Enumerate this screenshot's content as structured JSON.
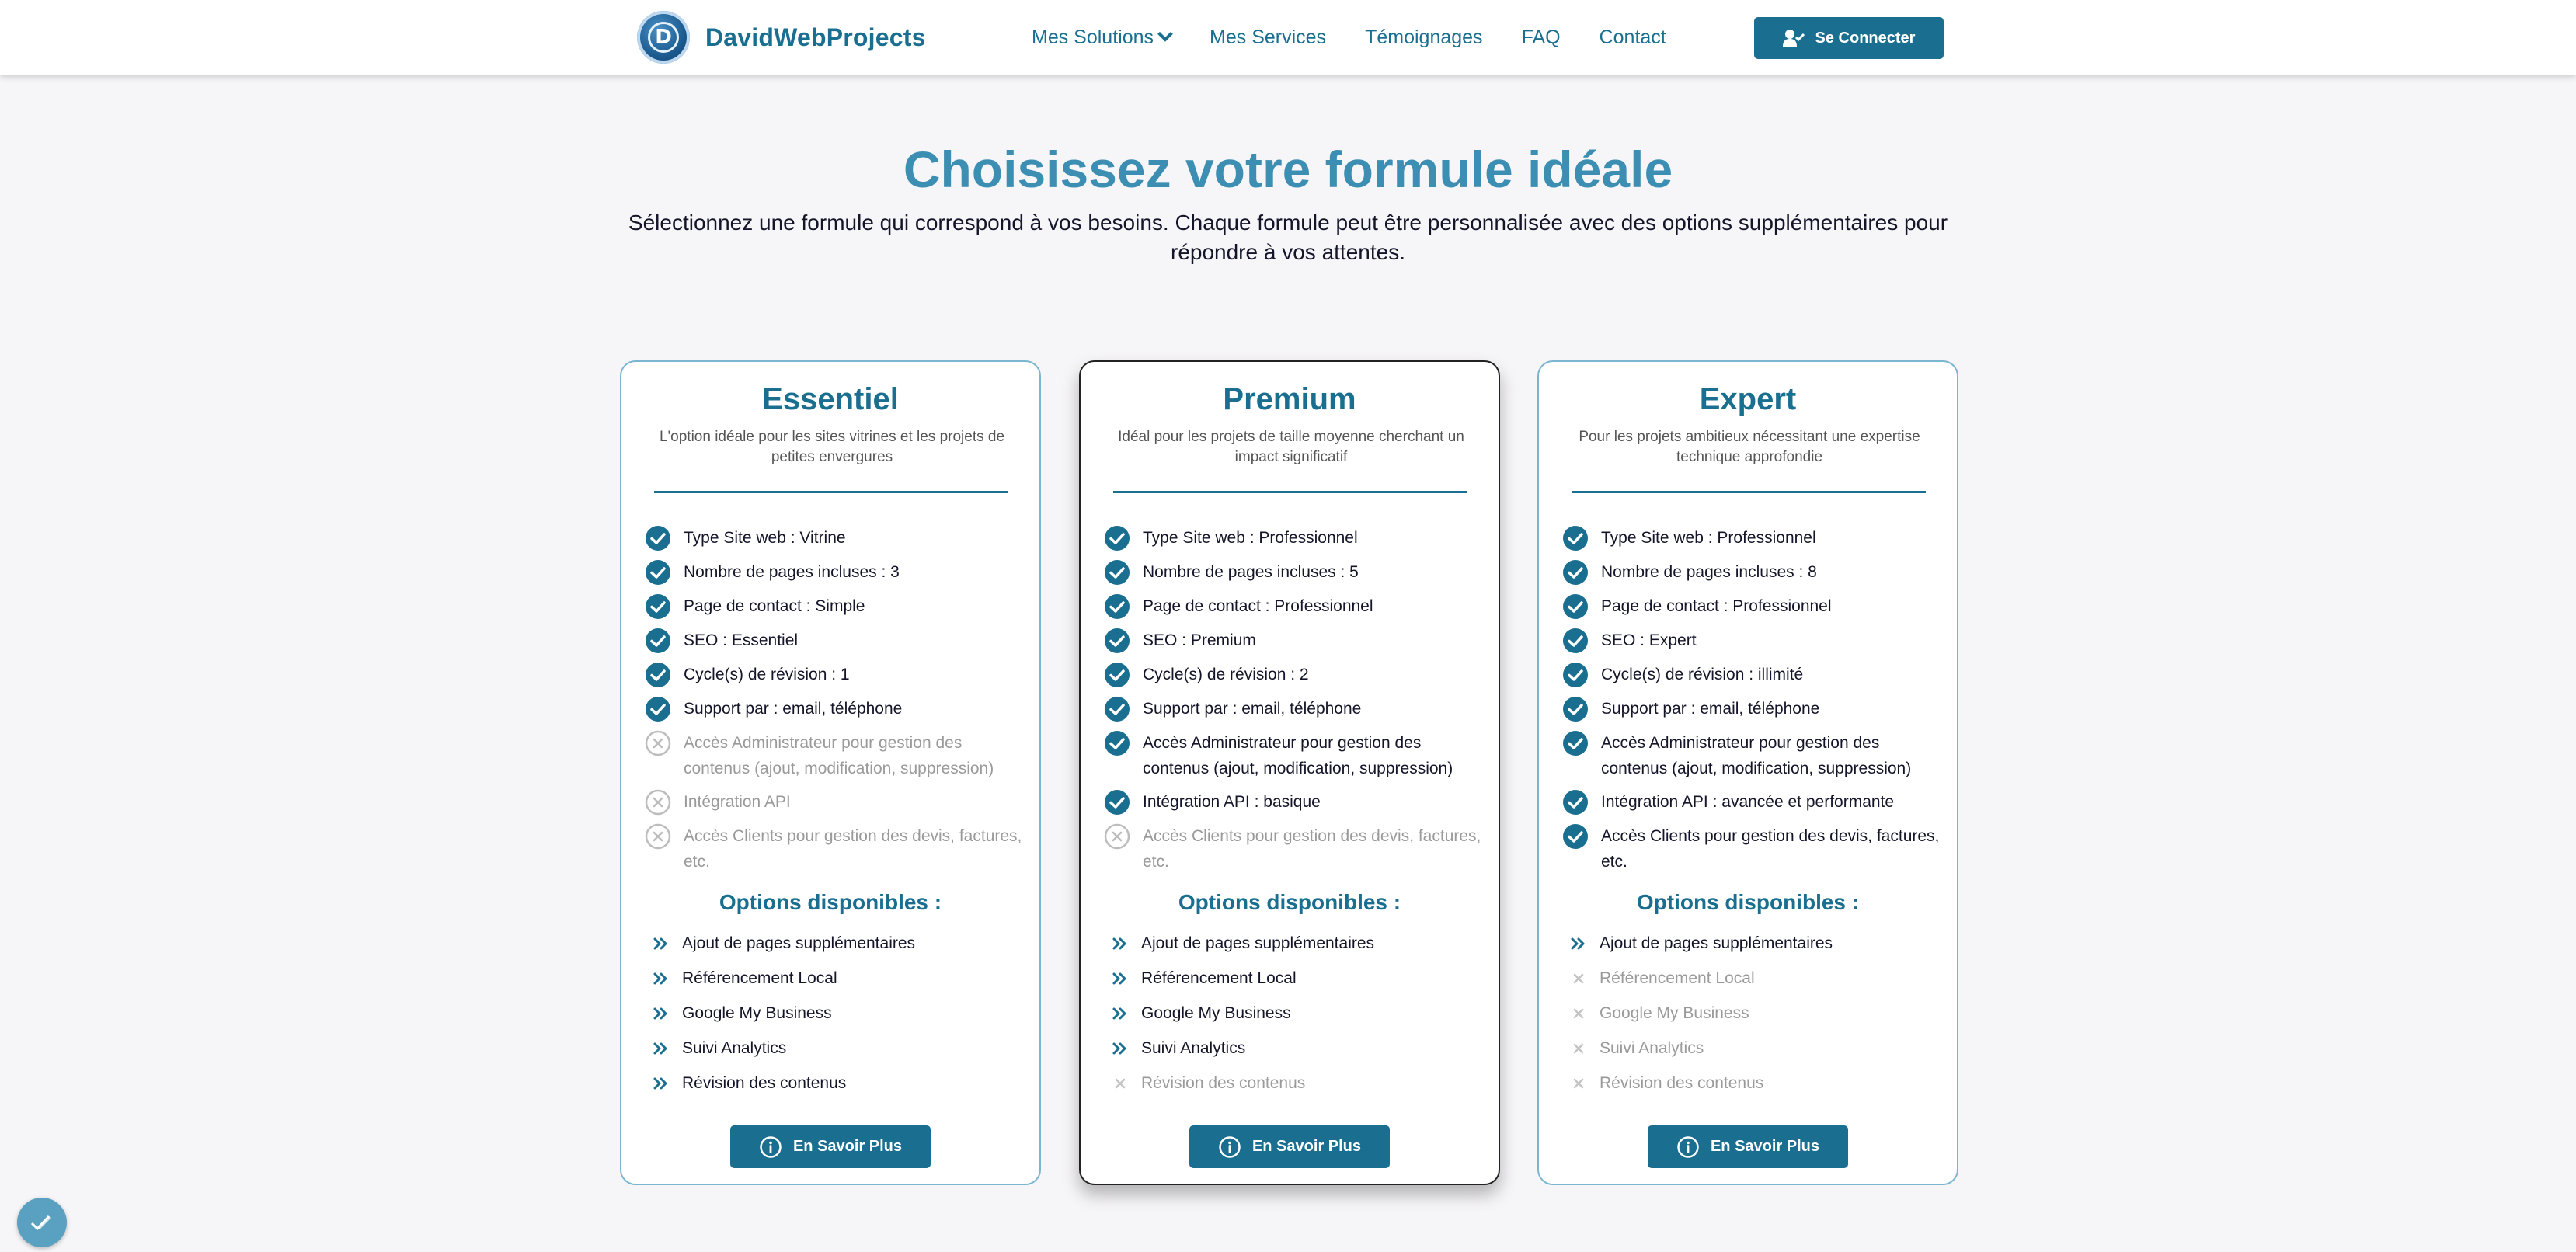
{
  "brand": {
    "name": "DavidWebProjects",
    "logo_letter": "D"
  },
  "nav": {
    "solutions": "Mes Solutions",
    "services": "Mes Services",
    "testimonials": "Témoignages",
    "faq": "FAQ",
    "contact": "Contact",
    "login": "Se Connecter"
  },
  "hero": {
    "title": "Choisissez votre formule idéale",
    "subtitle": "Sélectionnez une formule qui correspond à vos besoins. Chaque formule peut être personnalisée avec des options supplémentaires pour répondre à vos attentes."
  },
  "colors": {
    "accent": "#1a6f91",
    "title": "#3c8fb3",
    "disabled": "#9a9a9a"
  },
  "plans": [
    {
      "name": "Essentiel",
      "description": "L'option idéale pour les sites vitrines et les projets de petites envergures",
      "options_title": "Options disponibles :",
      "button": "En Savoir Plus",
      "features": [
        {
          "text": "Type Site web : Vitrine",
          "included": true
        },
        {
          "text": "Nombre de pages incluses : 3",
          "included": true
        },
        {
          "text": "Page de contact : Simple",
          "included": true
        },
        {
          "text": "SEO : Essentiel",
          "included": true
        },
        {
          "text": "Cycle(s) de révision : 1",
          "included": true
        },
        {
          "text": "Support par : email, téléphone",
          "included": true
        },
        {
          "text": "Accès Administrateur pour gestion des contenus (ajout, modification, suppression)",
          "included": false
        },
        {
          "text": "Intégration API",
          "included": false
        },
        {
          "text": "Accès Clients pour gestion des devis, factures, etc.",
          "included": false
        }
      ],
      "options": [
        {
          "text": "Ajout de pages supplémentaires",
          "available": true
        },
        {
          "text": "Référencement Local",
          "available": true
        },
        {
          "text": "Google My Business",
          "available": true
        },
        {
          "text": "Suivi Analytics",
          "available": true
        },
        {
          "text": "Révision des contenus",
          "available": true
        }
      ]
    },
    {
      "name": "Premium",
      "description": "Idéal pour les projets de taille moyenne cherchant un impact significatif",
      "options_title": "Options disponibles :",
      "button": "En Savoir Plus",
      "features": [
        {
          "text": "Type Site web : Professionnel",
          "included": true
        },
        {
          "text": "Nombre de pages incluses : 5",
          "included": true
        },
        {
          "text": "Page de contact : Professionnel",
          "included": true
        },
        {
          "text": "SEO : Premium",
          "included": true
        },
        {
          "text": "Cycle(s) de révision : 2",
          "included": true
        },
        {
          "text": "Support par : email, téléphone",
          "included": true
        },
        {
          "text": "Accès Administrateur pour gestion des contenus (ajout, modification, suppression)",
          "included": true
        },
        {
          "text": "Intégration API : basique",
          "included": true
        },
        {
          "text": "Accès Clients pour gestion des devis, factures, etc.",
          "included": false
        }
      ],
      "options": [
        {
          "text": "Ajout de pages supplémentaires",
          "available": true
        },
        {
          "text": "Référencement Local",
          "available": true
        },
        {
          "text": "Google My Business",
          "available": true
        },
        {
          "text": "Suivi Analytics",
          "available": true
        },
        {
          "text": "Révision des contenus",
          "available": false
        }
      ]
    },
    {
      "name": "Expert",
      "description": "Pour les projets ambitieux nécessitant une expertise technique approfondie",
      "options_title": "Options disponibles :",
      "button": "En Savoir Plus",
      "features": [
        {
          "text": "Type Site web : Professionnel",
          "included": true
        },
        {
          "text": "Nombre de pages incluses : 8",
          "included": true
        },
        {
          "text": "Page de contact : Professionnel",
          "included": true
        },
        {
          "text": "SEO : Expert",
          "included": true
        },
        {
          "text": "Cycle(s) de révision : illimité",
          "included": true
        },
        {
          "text": "Support par : email, téléphone",
          "included": true
        },
        {
          "text": "Accès Administrateur pour gestion des contenus (ajout, modification, suppression)",
          "included": true
        },
        {
          "text": "Intégration API : avancée et performante",
          "included": true
        },
        {
          "text": "Accès Clients pour gestion des devis, factures, etc.",
          "included": true
        }
      ],
      "options": [
        {
          "text": "Ajout de pages supplémentaires",
          "available": true
        },
        {
          "text": "Référencement Local",
          "available": false
        },
        {
          "text": "Google My Business",
          "available": false
        },
        {
          "text": "Suivi Analytics",
          "available": false
        },
        {
          "text": "Révision des contenus",
          "available": false
        }
      ]
    }
  ]
}
